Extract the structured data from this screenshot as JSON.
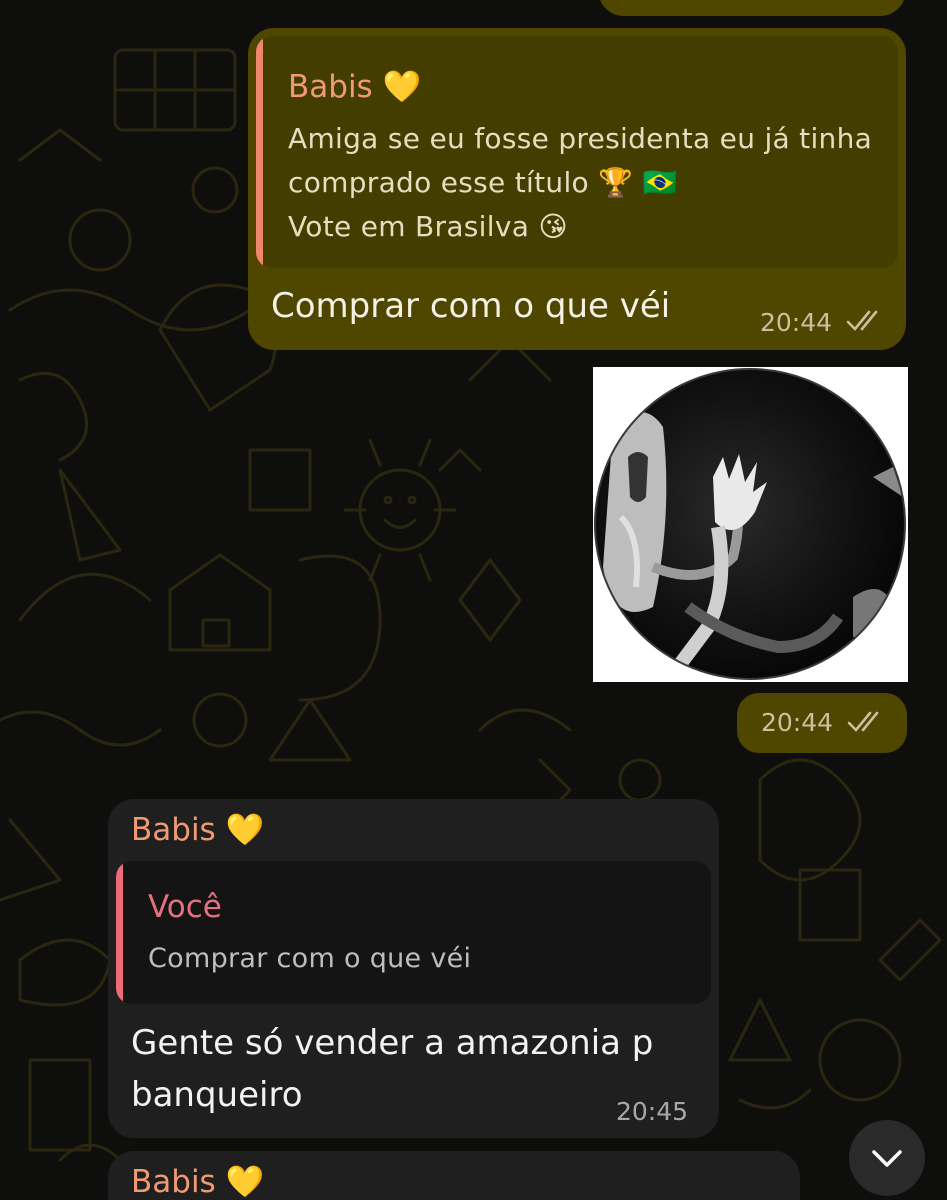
{
  "messages": [
    {
      "quote_sender": "Babis 💛",
      "quote_lines": [
        "Amiga se eu fosse presidenta eu já tinha",
        "comprado esse título 🏆 🇧🇷",
        "Vote em Brasilva 😘"
      ],
      "text": "Comprar com o que véi",
      "time": "20:44",
      "status_icon": "double-check-icon"
    },
    {
      "type": "sticker",
      "time": "20:44",
      "status_icon": "double-check-icon"
    },
    {
      "sender": "Babis 💛",
      "quote_sender": "Você",
      "quote_text": "Comprar com o que véi",
      "text_lines": [
        "Gente só vender a amazonia p",
        "banqueiro"
      ],
      "time": "20:45"
    },
    {
      "sender": "Babis 💛"
    }
  ],
  "colors": {
    "outgoing_bubble": "#4f4700",
    "incoming_bubble": "#1f1f1f",
    "sender_name": "#ef9a74",
    "quote_bar_incoming": "#ee6c7a"
  },
  "scroll_button_icon": "chevron-down-icon"
}
